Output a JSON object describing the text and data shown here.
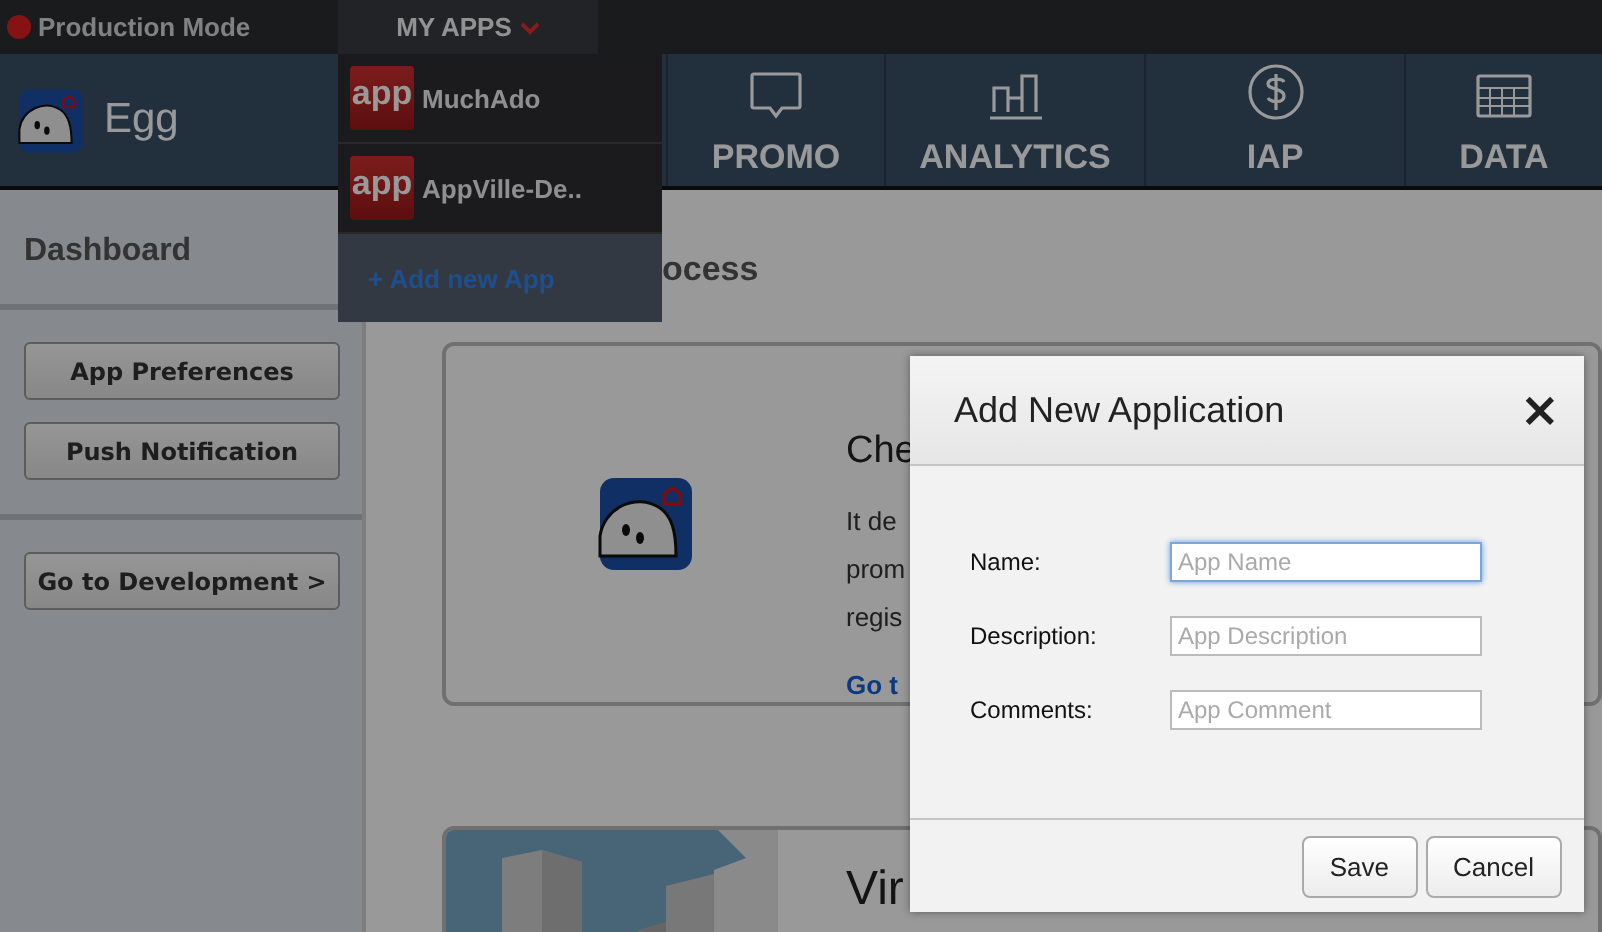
{
  "top_bar": {
    "status_label": "Production Mode",
    "menu": {
      "label": "MY APPS",
      "expanded": true
    }
  },
  "app_menu": {
    "items": [
      {
        "icon_label": "app",
        "name": "MuchAdo"
      },
      {
        "icon_label": "app",
        "name": "AppVille-De.."
      }
    ],
    "add_link": "+ Add new App"
  },
  "header": {
    "app_name": "Egg",
    "nav": [
      {
        "label": "PROMO",
        "kind": "chat"
      },
      {
        "label": "ANALYTICS",
        "kind": "bars"
      },
      {
        "label": "IAP",
        "kind": "dollar"
      },
      {
        "label": "DATA",
        "kind": "table"
      }
    ]
  },
  "sidebar": {
    "title": "Dashboard",
    "buttons": [
      "App Preferences",
      "Push Notification"
    ],
    "dev_button": "Go to Development >"
  },
  "content": {
    "heading": "ocess",
    "cards": [
      {
        "kind": "logo",
        "title": "Che",
        "lines": [
          "It de",
          "prom",
          "regis"
        ],
        "link": "Go t"
      },
      {
        "kind": "picture",
        "title": "Vir"
      }
    ]
  },
  "dialog": {
    "title": "Add New Application",
    "close": "×",
    "fields": [
      {
        "label": "Name:",
        "placeholder": "App Name",
        "focused": true
      },
      {
        "label": "Description:",
        "placeholder": "App Description",
        "focused": false
      },
      {
        "label": "Comments:",
        "placeholder": "App Comment",
        "focused": false
      }
    ],
    "buttons": [
      "Save",
      "Cancel"
    ]
  }
}
